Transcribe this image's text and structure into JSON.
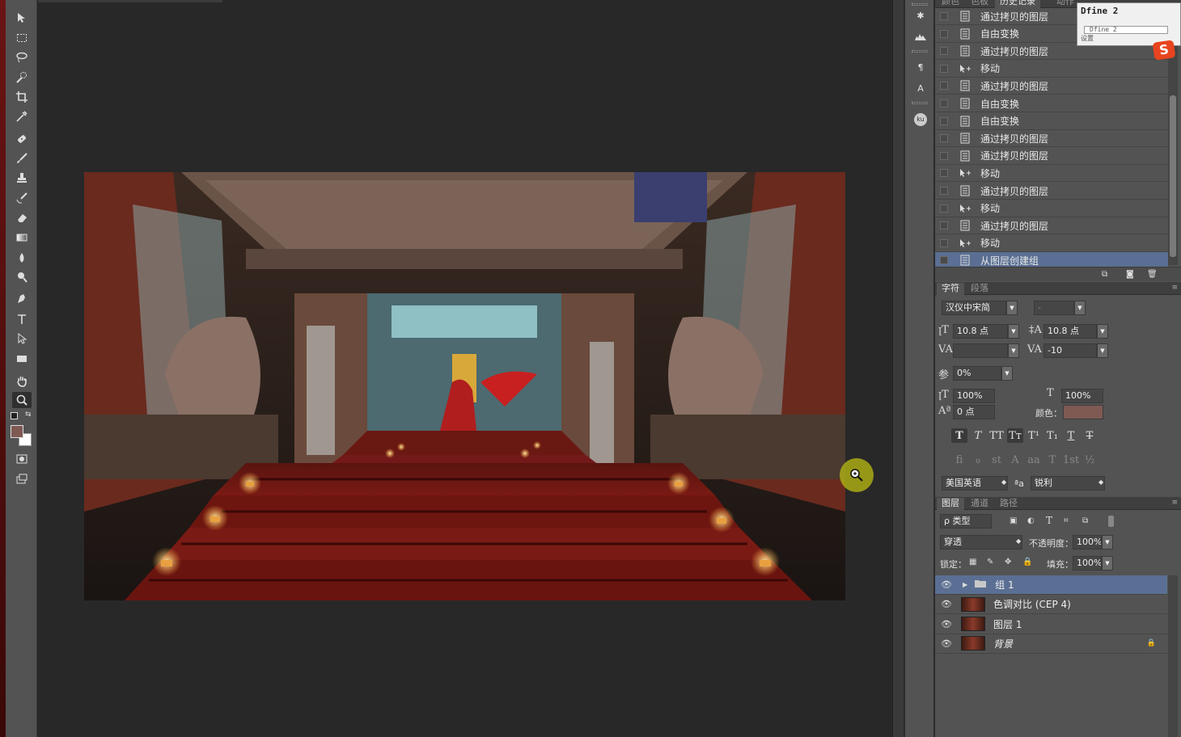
{
  "history": {
    "tabs": [
      "颜色",
      "色板",
      "历史记录",
      "动作"
    ],
    "active_tab": "历史记录",
    "items": [
      {
        "label": "通过拷贝的图层",
        "icon": "document-state-icon",
        "selected": false
      },
      {
        "label": "自由变换",
        "icon": "document-state-icon",
        "selected": false
      },
      {
        "label": "通过拷贝的图层",
        "icon": "document-state-icon",
        "selected": false
      },
      {
        "label": "移动",
        "icon": "move-tool-icon",
        "selected": false
      },
      {
        "label": "通过拷贝的图层",
        "icon": "document-state-icon",
        "selected": false
      },
      {
        "label": "自由变换",
        "icon": "document-state-icon",
        "selected": false
      },
      {
        "label": "自由变换",
        "icon": "document-state-icon",
        "selected": false
      },
      {
        "label": "通过拷贝的图层",
        "icon": "document-state-icon",
        "selected": false
      },
      {
        "label": "通过拷贝的图层",
        "icon": "document-state-icon",
        "selected": false
      },
      {
        "label": "移动",
        "icon": "move-tool-icon",
        "selected": false
      },
      {
        "label": "通过拷贝的图层",
        "icon": "document-state-icon",
        "selected": false
      },
      {
        "label": "移动",
        "icon": "move-tool-icon",
        "selected": false
      },
      {
        "label": "通过拷贝的图层",
        "icon": "document-state-icon",
        "selected": false
      },
      {
        "label": "移动",
        "icon": "move-tool-icon",
        "selected": false
      },
      {
        "label": "从图层创建组",
        "icon": "document-state-icon",
        "selected": true
      }
    ]
  },
  "character": {
    "tabs": [
      "字符",
      "段落"
    ],
    "active_tab": "字符",
    "font_family": "汉仪中宋简",
    "font_style": "-",
    "font_size": "10.8 点",
    "leading": "10.8 点",
    "kerning": "",
    "tracking": "-10",
    "tsume": "0%",
    "vertical_scale": "100%",
    "horizontal_scale": "100%",
    "baseline_shift": "0 点",
    "color_label": "颜色：",
    "color": "#7e5a53",
    "format_buttons": [
      "T",
      "T",
      "TT",
      "Tт",
      "T¹",
      "T₁",
      "T",
      "T"
    ],
    "opentype_buttons": [
      "fi",
      "ℴ",
      "st",
      "A",
      "aa",
      "T",
      "1st",
      "½"
    ],
    "language": "美国英语",
    "aa_label": "ªa",
    "antialias": "锐利"
  },
  "layers": {
    "tabs": [
      "图层",
      "通道",
      "路径"
    ],
    "active_tab": "图层",
    "filter_kind": "ρ 类型",
    "blend_mode": "穿透",
    "opacity_label": "不透明度：",
    "opacity": "100%",
    "lock_label": "锁定：",
    "fill_label": "填充：",
    "fill": "100%",
    "items": [
      {
        "name": "组 1",
        "type": "group",
        "selected": true,
        "visible": true
      },
      {
        "name": "色调对比 (CEP 4)",
        "type": "layer",
        "selected": false,
        "visible": true
      },
      {
        "name": "图层 1",
        "type": "layer",
        "selected": false,
        "visible": true
      },
      {
        "name": "背景",
        "type": "background",
        "selected": false,
        "visible": true,
        "locked": true
      }
    ]
  },
  "popup": {
    "title": "Dfine 2",
    "field": "Dfine 2",
    "sub": "设置"
  },
  "colors": {
    "selection": "#5a6f93",
    "panel_bg": "#535353",
    "canvas_bg": "#282828",
    "zoom_cursor": "#aaaa14"
  }
}
